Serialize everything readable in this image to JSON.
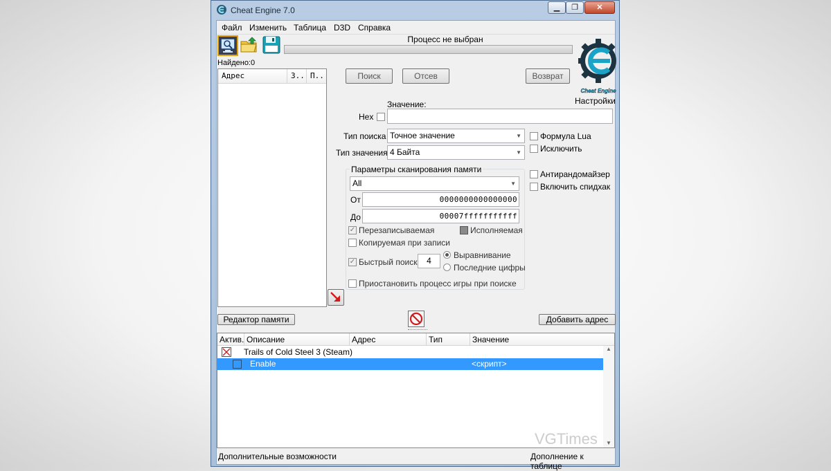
{
  "window": {
    "title": "Cheat Engine 7.0",
    "caption_minimize": "▁",
    "caption_maximize": "❐",
    "caption_close": "✕"
  },
  "menu": {
    "items": [
      "Файл",
      "Изменить",
      "Таблица",
      "D3D",
      "Справка"
    ]
  },
  "toolbar": {
    "open_process_icon": "computer-icon",
    "open_file_icon": "folder-icon",
    "save_icon": "floppy-icon"
  },
  "process": {
    "label": "Процесс не выбран"
  },
  "logo": {
    "text": "Cheat Engine",
    "settings_label": "Настройки"
  },
  "results": {
    "found_label": "Найдено:0",
    "columns": [
      "Адрес",
      "З..",
      "П.."
    ]
  },
  "scan_buttons": {
    "first_scan": "Поиск",
    "next_scan": "Отсев",
    "undo_scan": "Возврат"
  },
  "value": {
    "label": "Значение:",
    "hex_label": "Hex",
    "current_value": ""
  },
  "scan_type": {
    "label": "Тип поиска",
    "selected": "Точное значение"
  },
  "value_type": {
    "label": "Тип значения",
    "selected": "4 Байта"
  },
  "options_right": {
    "lua_formula": "Формула Lua",
    "exclude": "Исключить",
    "unrandomizer": "Антирандомайзер",
    "speedhack": "Включить спидхак"
  },
  "memory_scan": {
    "title": "Параметры сканирования памяти",
    "region_selected": "All",
    "from_label": "От",
    "from_value": "0000000000000000",
    "to_label": "До",
    "to_value": "00007fffffffffff",
    "writable": "Перезаписываемая",
    "executable": "Исполняемая",
    "copy_on_write": "Копируемая при записи",
    "fast_scan": "Быстрый поиск",
    "fast_scan_value": "4",
    "alignment": "Выравнивание",
    "last_digits": "Последние цифры",
    "pause_game": "Приостановить процесс игры при поиске"
  },
  "middle_bar": {
    "memory_view": "Редактор памяти",
    "add_address": "Добавить адрес"
  },
  "cheat_table": {
    "columns": [
      "Актив.",
      "Описание",
      "Адрес",
      "Тип",
      "Значение"
    ],
    "rows": [
      {
        "description": "Trails of Cold Steel 3 (Steam)",
        "value": ""
      },
      {
        "description": "Enable",
        "value": "<скрипт>"
      }
    ]
  },
  "statusbar": {
    "left": "Дополнительные возможности",
    "right": "Дополнение к таблице"
  },
  "watermark": "VGTimes"
}
